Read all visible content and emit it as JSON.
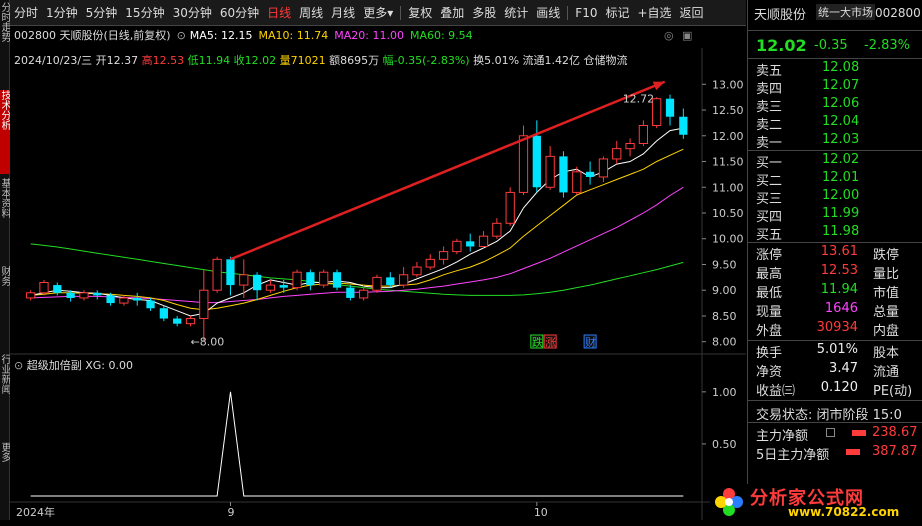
{
  "left_tabs": [
    "分时走势",
    "技术分析",
    "基本资料",
    "财务",
    "行业新闻",
    "更多"
  ],
  "toolbar": {
    "items": [
      "分时",
      "1分钟",
      "5分钟",
      "15分钟",
      "30分钟",
      "60分钟",
      "日线",
      "周线",
      "月线",
      "更多",
      "复权",
      "叠加",
      "多股",
      "统计",
      "画线",
      "F10",
      "标记",
      "+自选",
      "返回"
    ],
    "active": "日线",
    "more_arrow": "▾"
  },
  "info": {
    "code_name": "002800 天顺股份(日线,前复权)",
    "ma5": "MA5: 12.15",
    "ma10": "MA10: 11.74",
    "ma20": "MA20: 11.00",
    "ma60": "MA60: 9.54",
    "ma5_color": "#ffffff",
    "ma10_color": "#ffd400",
    "ma20_color": "#ff44ff",
    "ma60_color": "#22dd22"
  },
  "ohlc": {
    "date": "2024/10/23/三",
    "open": "开12.37",
    "high": "高12.53",
    "low": "低11.94",
    "close": "收12.02",
    "vol": "量71021",
    "amt": "额8695万",
    "range": "幅-0.35(-2.83%)",
    "turnover": "换5.01%",
    "float": "流通1.42亿",
    "tags": "仓储物流"
  },
  "chart_data": {
    "type": "candlestick",
    "candles": [
      [
        8.85,
        8.95,
        8.8,
        9.0
      ],
      [
        8.95,
        9.15,
        8.9,
        9.2
      ],
      [
        9.1,
        8.95,
        8.9,
        9.15
      ],
      [
        8.95,
        8.85,
        8.78,
        9.0
      ],
      [
        8.85,
        8.95,
        8.8,
        9.0
      ],
      [
        8.95,
        8.9,
        8.82,
        9.0
      ],
      [
        8.9,
        8.75,
        8.7,
        8.95
      ],
      [
        8.75,
        8.85,
        8.7,
        8.9
      ],
      [
        8.85,
        8.8,
        8.7,
        8.95
      ],
      [
        8.8,
        8.65,
        8.6,
        8.85
      ],
      [
        8.65,
        8.45,
        8.4,
        8.7
      ],
      [
        8.45,
        8.35,
        8.3,
        8.5
      ],
      [
        8.35,
        8.45,
        8.3,
        8.5
      ],
      [
        8.45,
        9.0,
        8.0,
        9.4
      ],
      [
        9.0,
        9.6,
        8.95,
        9.65
      ],
      [
        9.6,
        9.1,
        8.9,
        9.65
      ],
      [
        9.1,
        9.3,
        8.85,
        9.6
      ],
      [
        9.3,
        9.0,
        8.8,
        9.35
      ],
      [
        9.0,
        9.1,
        8.95,
        9.2
      ],
      [
        9.1,
        9.05,
        8.95,
        9.2
      ],
      [
        9.05,
        9.35,
        9.0,
        9.4
      ],
      [
        9.35,
        9.1,
        9.0,
        9.4
      ],
      [
        9.1,
        9.35,
        9.05,
        9.4
      ],
      [
        9.35,
        9.05,
        9.0,
        9.4
      ],
      [
        9.05,
        8.85,
        8.8,
        9.1
      ],
      [
        8.85,
        9.0,
        8.8,
        9.1
      ],
      [
        9.0,
        9.25,
        8.95,
        9.3
      ],
      [
        9.25,
        9.1,
        9.05,
        9.35
      ],
      [
        9.1,
        9.3,
        9.05,
        9.45
      ],
      [
        9.3,
        9.45,
        9.25,
        9.55
      ],
      [
        9.45,
        9.6,
        9.4,
        9.7
      ],
      [
        9.6,
        9.75,
        9.5,
        9.85
      ],
      [
        9.75,
        9.95,
        9.7,
        10.0
      ],
      [
        9.95,
        9.85,
        9.75,
        10.1
      ],
      [
        9.85,
        10.05,
        9.8,
        10.15
      ],
      [
        10.05,
        10.3,
        10.0,
        10.4
      ],
      [
        10.3,
        10.9,
        10.25,
        11.0
      ],
      [
        10.9,
        12.0,
        10.85,
        12.2
      ],
      [
        12.0,
        11.0,
        10.9,
        12.3
      ],
      [
        11.0,
        11.6,
        10.95,
        11.8
      ],
      [
        11.6,
        10.9,
        10.8,
        11.7
      ],
      [
        10.9,
        11.3,
        10.85,
        11.4
      ],
      [
        11.3,
        11.2,
        11.05,
        11.5
      ],
      [
        11.2,
        11.55,
        11.1,
        11.6
      ],
      [
        11.55,
        11.75,
        11.45,
        11.9
      ],
      [
        11.75,
        11.85,
        11.6,
        11.95
      ],
      [
        11.85,
        12.2,
        11.8,
        12.3
      ],
      [
        12.2,
        12.72,
        12.15,
        12.75
      ],
      [
        12.72,
        12.37,
        12.2,
        12.8
      ],
      [
        12.37,
        12.02,
        11.94,
        12.53
      ]
    ],
    "ma5": [
      8.9,
      8.95,
      9.0,
      8.98,
      8.95,
      8.94,
      8.9,
      8.85,
      8.82,
      8.8,
      8.7,
      8.6,
      8.5,
      8.55,
      8.75,
      8.85,
      8.95,
      9.1,
      9.2,
      9.15,
      9.1,
      9.15,
      9.15,
      9.18,
      9.15,
      9.08,
      9.05,
      9.05,
      9.12,
      9.22,
      9.32,
      9.42,
      9.55,
      9.7,
      9.82,
      9.95,
      10.15,
      10.6,
      10.9,
      11.15,
      11.3,
      11.35,
      11.2,
      11.3,
      11.45,
      11.5,
      11.65,
      11.9,
      12.1,
      12.15
    ],
    "ma10": [
      8.9,
      8.92,
      8.95,
      8.95,
      8.94,
      8.93,
      8.92,
      8.9,
      8.88,
      8.85,
      8.8,
      8.72,
      8.65,
      8.62,
      8.65,
      8.7,
      8.75,
      8.82,
      8.9,
      8.98,
      9.05,
      9.1,
      9.12,
      9.14,
      9.12,
      9.1,
      9.08,
      9.08,
      9.1,
      9.12,
      9.2,
      9.3,
      9.38,
      9.45,
      9.55,
      9.68,
      9.82,
      10.05,
      10.25,
      10.45,
      10.65,
      10.85,
      10.95,
      11.05,
      11.15,
      11.25,
      11.35,
      11.5,
      11.62,
      11.74
    ],
    "ma20": [
      8.85,
      8.86,
      8.87,
      8.88,
      8.88,
      8.88,
      8.87,
      8.86,
      8.85,
      8.84,
      8.82,
      8.8,
      8.78,
      8.76,
      8.76,
      8.78,
      8.8,
      8.82,
      8.85,
      8.88,
      8.9,
      8.92,
      8.94,
      8.96,
      8.96,
      8.96,
      8.97,
      8.98,
      9.0,
      9.02,
      9.05,
      9.08,
      9.12,
      9.16,
      9.2,
      9.25,
      9.32,
      9.42,
      9.52,
      9.62,
      9.74,
      9.86,
      9.98,
      10.1,
      10.22,
      10.36,
      10.5,
      10.66,
      10.84,
      11.0
    ],
    "ma60": [
      9.9,
      9.87,
      9.84,
      9.8,
      9.76,
      9.72,
      9.68,
      9.64,
      9.6,
      9.56,
      9.52,
      9.48,
      9.44,
      9.4,
      9.36,
      9.33,
      9.3,
      9.27,
      9.24,
      9.22,
      9.2,
      9.17,
      9.14,
      9.11,
      9.08,
      9.05,
      9.02,
      9.0,
      8.98,
      8.96,
      8.94,
      8.92,
      8.91,
      8.9,
      8.9,
      8.9,
      8.9,
      8.91,
      8.93,
      8.96,
      9.0,
      9.05,
      9.1,
      9.16,
      9.22,
      9.28,
      9.34,
      9.4,
      9.47,
      9.54
    ],
    "ylim": [
      7.8,
      13.2
    ],
    "yticks": [
      8.0,
      8.5,
      9.0,
      9.5,
      10.0,
      10.5,
      11.0,
      11.5,
      12.0,
      12.5,
      13.0
    ],
    "ytick_labels": [
      "8.00",
      "8.50",
      "9.00",
      "9.50",
      "10.00",
      "10.50",
      "11.00",
      "11.50",
      "12.00",
      "12.50",
      "13.00"
    ],
    "xtick_labels": [
      {
        "label": "2024年",
        "index": 0
      },
      {
        "label": "9",
        "index": 15
      },
      {
        "label": "10",
        "index": 38
      }
    ],
    "annotations": [
      {
        "text": "←8.00",
        "index": 12,
        "value": 8.0
      },
      {
        "text": "12.72",
        "index": 47,
        "value": 12.72
      }
    ],
    "markers": [
      {
        "text": "跌",
        "index": 38
      },
      {
        "text": "涨",
        "index": 39
      },
      {
        "text": "财",
        "index": 42
      }
    ],
    "indicator": {
      "name": "超级加倍副",
      "label": "XG: 0.00",
      "spike_index": 15,
      "ylim": [
        0,
        1.2
      ],
      "ytick_labels": [
        "0.50",
        "1.00"
      ],
      "yticks": [
        0.5,
        1.0
      ]
    },
    "colors": {
      "up": "#ff3b3b",
      "down": "#00e5ff",
      "ma5": "#ffffff",
      "ma10": "#ffd400",
      "ma20": "#ff44ff",
      "ma60": "#22dd22"
    }
  },
  "right_panel": {
    "title": "天顺股份",
    "market": "统一大市场",
    "code": "002800",
    "price": "12.02",
    "change": "-0.35",
    "pct": "-2.83%",
    "sells": [
      {
        "label": "卖五",
        "price": "12.08"
      },
      {
        "label": "卖四",
        "price": "12.07"
      },
      {
        "label": "卖三",
        "price": "12.06"
      },
      {
        "label": "卖二",
        "price": "12.04"
      },
      {
        "label": "卖一",
        "price": "12.03"
      }
    ],
    "buys": [
      {
        "label": "买一",
        "price": "12.02"
      },
      {
        "label": "买二",
        "price": "12.01"
      },
      {
        "label": "买三",
        "price": "12.00"
      },
      {
        "label": "买四",
        "price": "11.99"
      },
      {
        "label": "买五",
        "price": "11.98"
      }
    ],
    "stats": [
      {
        "l": "涨停",
        "v": "13.61",
        "c": "red",
        "l2": "跌停"
      },
      {
        "l": "最高",
        "v": "12.53",
        "c": "red",
        "l2": "量比"
      },
      {
        "l": "最低",
        "v": "11.94",
        "c": "green",
        "l2": "市值"
      },
      {
        "l": "现量",
        "v": "1646",
        "c": "magenta",
        "l2": "总量"
      },
      {
        "l": "外盘",
        "v": "30934",
        "c": "red",
        "l2": "内盘"
      }
    ],
    "stats2": [
      {
        "l": "换手",
        "v": "5.01%",
        "l2": "股本"
      },
      {
        "l": "净资",
        "v": "3.47",
        "l2": "流通"
      },
      {
        "l": "收益㈢",
        "v": "0.120",
        "l2": "PE(动)"
      }
    ],
    "trade_status": "交易状态: 闭市阶段 15:0",
    "flow": [
      {
        "l": "主力净额",
        "v": "238.67"
      },
      {
        "l": "5日主力净额",
        "v": "387.87"
      }
    ],
    "logo": "分析家公式网",
    "logo_url": "www.70822.com"
  }
}
